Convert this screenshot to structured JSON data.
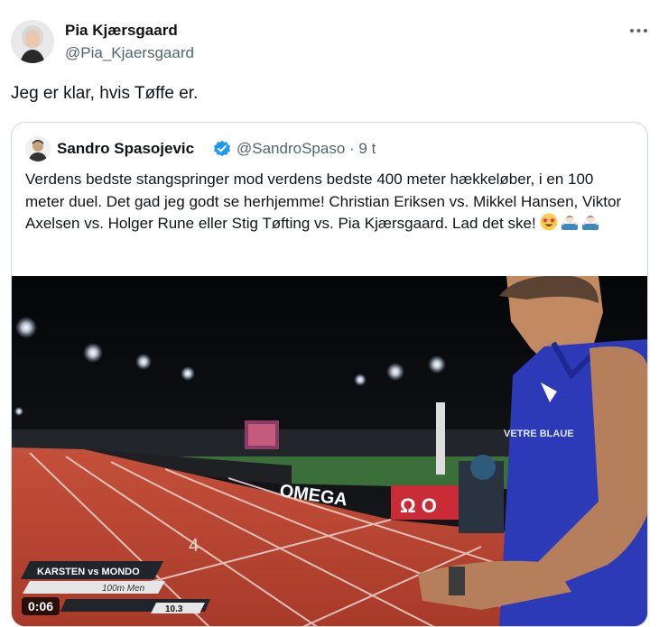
{
  "author": {
    "name": "Pia Kjærsgaard",
    "handle": "@Pia_Kjaersgaard"
  },
  "tweet": {
    "text": "Jeg er klar, hvis Tøffe er."
  },
  "quoted": {
    "name": "Sandro Spasojevic",
    "handle": "@SandroSpaso · 9 t",
    "text": "Verdens bedste stangspringer mod verdens bedste 400 meter hækkeløber, i en 100 meter duel. Det gad jeg godt se herhjemme! Christian Eriksen vs. Mikkel Hansen, Viktor Axelsen vs. Holger Rune eller Stig Tøfting vs. Pia Kjærsgaard. Lad det ske!",
    "media": {
      "banner_left": "KARSTEN vs MONDO",
      "banner_sub": "100m Men",
      "sponsor": "OMEGA",
      "sponsor2": "Ω O",
      "track_number": "4",
      "jersey_text": "VETRE BLAUE",
      "timer_partial": "10.3",
      "duration": "0:06"
    }
  },
  "colors": {
    "verified": "#1d9bf0",
    "handle": "#536471",
    "border": "#cfd9de"
  }
}
